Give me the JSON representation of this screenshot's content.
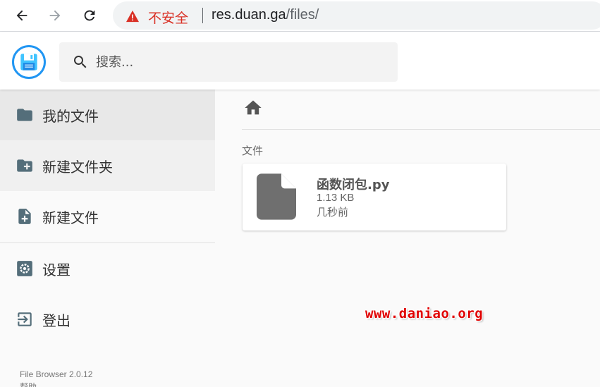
{
  "browser": {
    "security_label": "不安全",
    "url_host": "res.duan.ga",
    "url_path": "/files/"
  },
  "header": {
    "search_placeholder": "搜索..."
  },
  "sidebar": {
    "items": [
      {
        "label": "我的文件",
        "icon": "folder-icon"
      },
      {
        "label": "新建文件夹",
        "icon": "create-folder-icon"
      },
      {
        "label": "新建文件",
        "icon": "note-add-icon"
      },
      {
        "label": "设置",
        "icon": "settings-icon"
      },
      {
        "label": "登出",
        "icon": "exit-icon"
      }
    ],
    "version": "File Browser 2.0.12",
    "help": "帮助"
  },
  "main": {
    "section_label": "文件",
    "files": [
      {
        "name": "函数闭包.py",
        "size": "1.13 KB",
        "modified": "几秒前",
        "icon": "file-icon"
      }
    ]
  },
  "watermark": "www.daniao.org",
  "colors": {
    "accent": "#2196f3",
    "warning": "#d93025",
    "icon_gray": "#546e7a",
    "watermark": "#e00000"
  }
}
